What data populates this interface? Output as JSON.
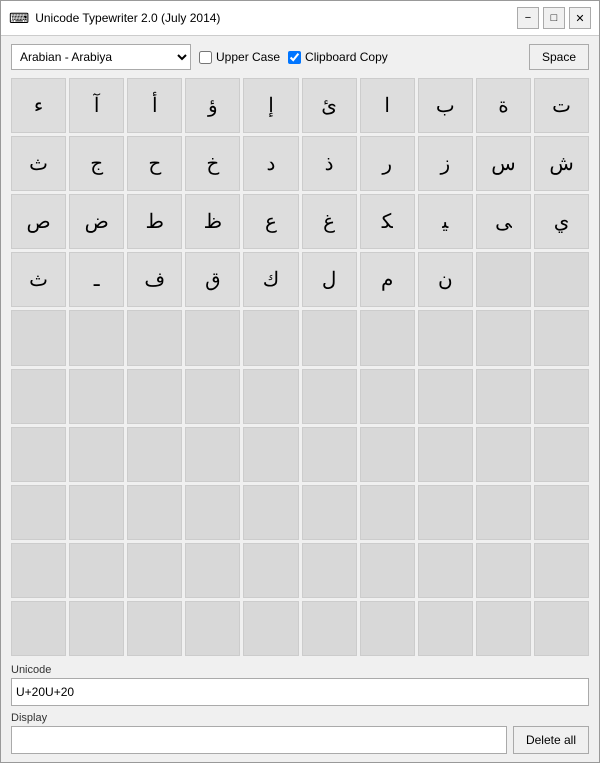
{
  "window": {
    "title": "Unicode Typewriter 2.0 (July 2014)"
  },
  "toolbar": {
    "language_value": "Arabian    - Arabiya",
    "uppercase_label": "Upper Case",
    "clipboard_label": "Clipboard Copy",
    "space_label": "Space",
    "uppercase_checked": false,
    "clipboard_checked": true
  },
  "title_controls": {
    "minimize": "−",
    "maximize": "□",
    "close": "✕"
  },
  "bottom": {
    "unicode_label": "Unicode",
    "unicode_value": "U+20U+20",
    "display_label": "Display",
    "delete_all_label": "Delete all"
  },
  "characters": [
    "ء",
    "آ",
    "أ",
    "ؤ",
    "إ",
    "ئ",
    "ا",
    "ب",
    "ة",
    "ت",
    "ث",
    "ج",
    "ح",
    "خ",
    "د",
    "ذ",
    "ر",
    "ز",
    "س",
    "ش",
    "ص",
    "ض",
    "ط",
    "ظ",
    "ع",
    "غ",
    "ﻜ",
    "ﻴ",
    "ﻰ",
    "ﻱ",
    "ﺙ",
    "ـ",
    "ف",
    "ق",
    "ك",
    "ل",
    "م",
    "ن",
    "",
    "",
    "",
    "",
    "",
    "",
    "",
    "",
    "",
    "",
    "",
    "",
    "",
    "",
    "",
    "",
    "",
    "",
    "",
    "",
    "",
    "",
    "",
    "",
    "",
    "",
    "",
    "",
    "",
    "",
    "",
    "",
    "",
    "",
    "",
    "",
    "",
    "",
    "",
    "",
    "",
    "",
    "",
    "",
    "",
    "",
    "",
    "",
    "",
    "",
    "",
    "",
    "",
    "",
    "",
    "",
    "",
    "",
    "",
    "",
    "",
    ""
  ]
}
